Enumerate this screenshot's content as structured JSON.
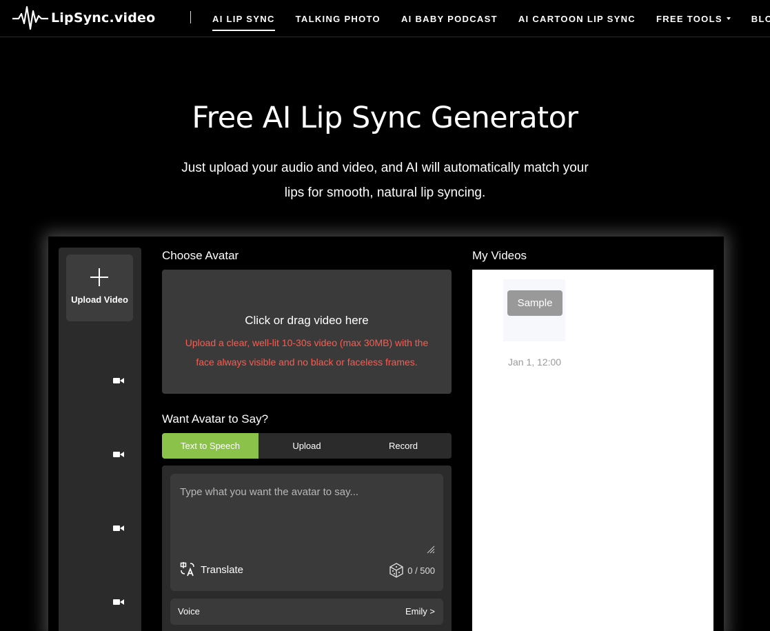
{
  "brand": {
    "name": "LipSync.video"
  },
  "nav": {
    "items": [
      {
        "label": "AI LIP SYNC"
      },
      {
        "label": "TALKING PHOTO"
      },
      {
        "label": "AI BABY PODCAST"
      },
      {
        "label": "AI CARTOON LIP SYNC"
      },
      {
        "label": "FREE TOOLS"
      },
      {
        "label": "BLOG"
      }
    ],
    "active_index": 0
  },
  "hero": {
    "title": "Free AI Lip Sync Generator",
    "subtitle_line1": "Just upload your audio and video, and AI will automatically match your",
    "subtitle_line2": "lips for smooth, natural lip syncing."
  },
  "sidebar": {
    "upload_label": "Upload Video",
    "icons": [
      "video-camera-icon",
      "video-camera-icon",
      "video-camera-icon",
      "video-camera-icon"
    ]
  },
  "avatar": {
    "heading": "Choose Avatar",
    "dropzone_title": "Click or drag video here",
    "dropzone_hint": "Upload a clear, well-lit 10-30s video (max 30MB) with the face always visible and no black or faceless frames."
  },
  "speech": {
    "heading": "Want Avatar to Say?",
    "tabs": [
      {
        "label": "Text to Speech"
      },
      {
        "label": "Upload"
      },
      {
        "label": "Record"
      }
    ],
    "active_tab": 0,
    "text_placeholder": "Type what you want the avatar to say...",
    "text_value": "",
    "translate_label": "Translate",
    "char_count": "0 / 500",
    "voice_label": "Voice",
    "voice_value": "Emily >"
  },
  "videos": {
    "heading": "My Videos",
    "items": [
      {
        "button": "Sample",
        "date": "Jan 1, 12:00"
      }
    ]
  },
  "colors": {
    "accent": "#8bc34a",
    "warning": "#ff5a4f",
    "panel": "#2b2b2b",
    "field": "#3a3a3a"
  }
}
